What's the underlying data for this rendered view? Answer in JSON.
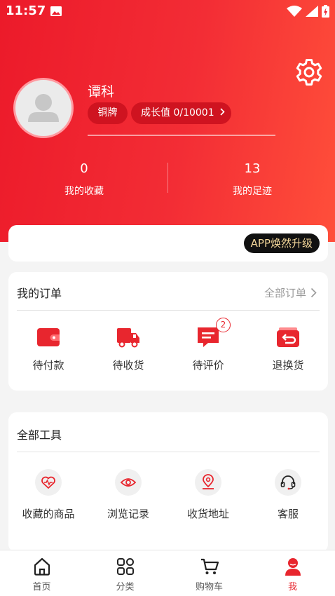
{
  "status_bar": {
    "time": "11:57"
  },
  "profile": {
    "name": "谭科",
    "level": "铜牌",
    "growth_label": "成长值",
    "growth_value": "0/10001",
    "growth_progress": 0
  },
  "stats": [
    {
      "value": "0",
      "label": "我的收藏"
    },
    {
      "value": "13",
      "label": "我的足迹"
    }
  ],
  "upgrade": {
    "label": "APP焕然升级"
  },
  "orders": {
    "title": "我的订单",
    "more": "全部订单",
    "items": [
      {
        "label": "待付款",
        "icon": "wallet-icon"
      },
      {
        "label": "待收货",
        "icon": "truck-icon"
      },
      {
        "label": "待评价",
        "icon": "comment-icon",
        "badge": "2"
      },
      {
        "label": "退换货",
        "icon": "return-icon"
      }
    ]
  },
  "tools": {
    "title": "全部工具",
    "items": [
      {
        "label": "收藏的商品",
        "icon": "heart-pulse-icon"
      },
      {
        "label": "浏览记录",
        "icon": "eye-icon"
      },
      {
        "label": "收货地址",
        "icon": "location-pin-icon"
      },
      {
        "label": "客服",
        "icon": "headset-icon"
      }
    ]
  },
  "tabbar": {
    "items": [
      {
        "label": "首页",
        "icon": "home-icon"
      },
      {
        "label": "分类",
        "icon": "category-icon"
      },
      {
        "label": "购物车",
        "icon": "cart-icon"
      },
      {
        "label": "我",
        "icon": "user-icon",
        "active": true
      }
    ]
  },
  "colors": {
    "brand": "#ec1a2a",
    "accent_gold": "#f3d79a"
  }
}
